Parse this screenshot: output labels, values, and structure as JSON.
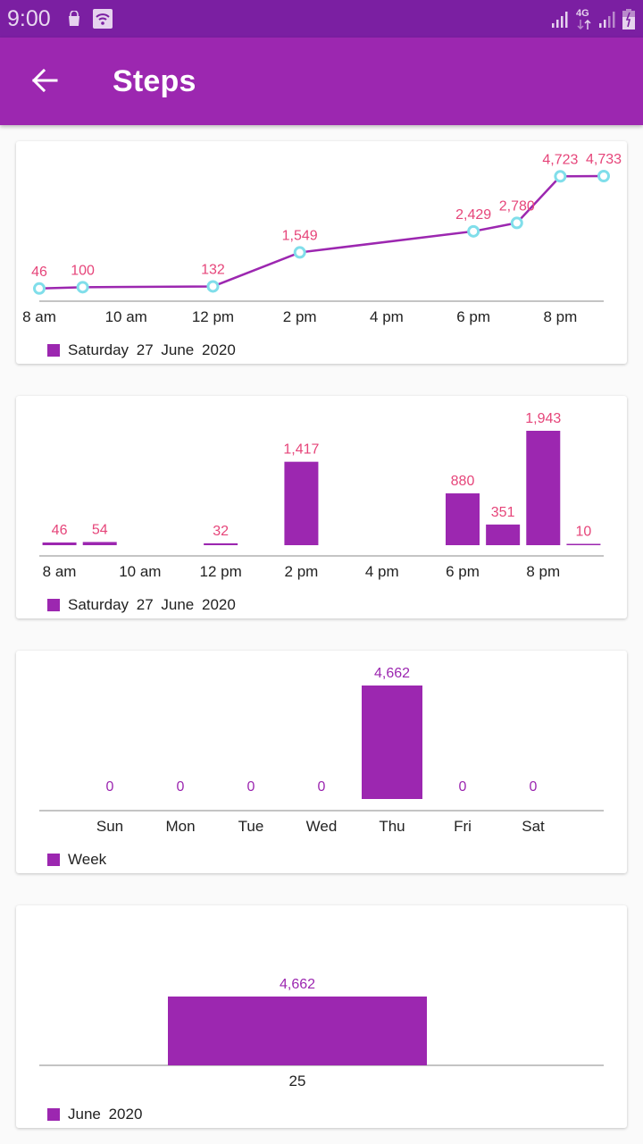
{
  "status_bar": {
    "time": "9:00",
    "icons": [
      "shopping-bag-icon",
      "wifi-icon",
      "signal-icon",
      "4g-icon",
      "signal-icon",
      "battery-charging-icon"
    ],
    "network_label": "4G",
    "battery_label": "7"
  },
  "app_bar": {
    "back_icon": "arrow-left-icon",
    "title": "Steps"
  },
  "colors": {
    "primary": "#9c27b0",
    "primary_dark": "#7b1fa2",
    "value_label_pink": "#e6457a",
    "point_ring": "#80deea"
  },
  "chart_data": [
    {
      "type": "line",
      "title": "",
      "legend": "Saturday 27 June 2020",
      "legend_position": "bottom-left",
      "x_ticks": [
        "8 am",
        "10 am",
        "12 pm",
        "2 pm",
        "4 pm",
        "6 pm",
        "8 pm"
      ],
      "x_tick_hours": [
        8,
        10,
        12,
        14,
        16,
        18,
        20
      ],
      "xlim": [
        8,
        21
      ],
      "points": [
        {
          "hour": 8,
          "value": 46,
          "label": "46"
        },
        {
          "hour": 9,
          "value": 100,
          "label": "100"
        },
        {
          "hour": 12,
          "value": 132,
          "label": "132"
        },
        {
          "hour": 14,
          "value": 1549,
          "label": "1,549"
        },
        {
          "hour": 18,
          "value": 2429,
          "label": "2,429"
        },
        {
          "hour": 19,
          "value": 2780,
          "label": "2,780"
        },
        {
          "hour": 20,
          "value": 4723,
          "label": "4,723"
        },
        {
          "hour": 21,
          "value": 4733,
          "label": "4,733"
        }
      ],
      "grid": false
    },
    {
      "type": "bar",
      "title": "",
      "legend": "Saturday 27 June 2020",
      "legend_position": "bottom-left",
      "x_ticks": [
        "8 am",
        "10 am",
        "12 pm",
        "2 pm",
        "4 pm",
        "6 pm",
        "8 pm"
      ],
      "x_tick_hours": [
        8,
        10,
        12,
        14,
        16,
        18,
        20
      ],
      "xlim": [
        8,
        21
      ],
      "bars": [
        {
          "hour": 8,
          "value": 46,
          "label": "46"
        },
        {
          "hour": 9,
          "value": 54,
          "label": "54"
        },
        {
          "hour": 12,
          "value": 32,
          "label": "32"
        },
        {
          "hour": 14,
          "value": 1417,
          "label": "1,417"
        },
        {
          "hour": 18,
          "value": 880,
          "label": "880"
        },
        {
          "hour": 19,
          "value": 351,
          "label": "351"
        },
        {
          "hour": 20,
          "value": 1943,
          "label": "1,943"
        },
        {
          "hour": 21,
          "value": 10,
          "label": "10"
        }
      ],
      "grid": false
    },
    {
      "type": "bar",
      "title": "",
      "legend": "Week",
      "legend_position": "bottom-left",
      "categories": [
        "Sun",
        "Mon",
        "Tue",
        "Wed",
        "Thu",
        "Fri",
        "Sat"
      ],
      "values": [
        0,
        0,
        0,
        0,
        4662,
        0,
        0
      ],
      "value_labels": [
        "0",
        "0",
        "0",
        "0",
        "4,662",
        "0",
        "0"
      ],
      "grid": false
    },
    {
      "type": "bar",
      "title": "",
      "legend": "June 2020",
      "legend_position": "bottom-left",
      "categories": [
        "25"
      ],
      "values": [
        4662
      ],
      "value_labels": [
        "4,662"
      ],
      "grid": false
    }
  ]
}
